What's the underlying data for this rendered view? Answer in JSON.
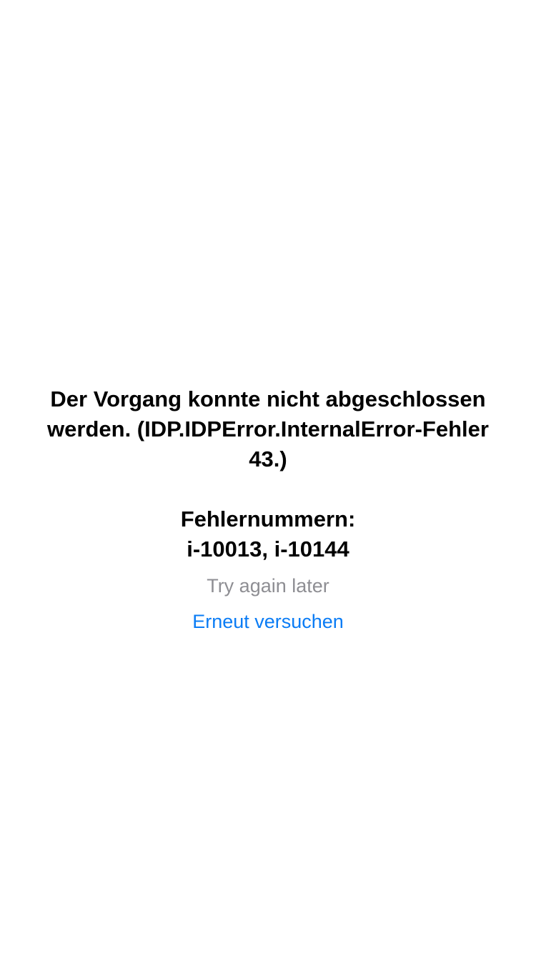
{
  "error": {
    "message": "Der Vorgang konnte nicht abgeschlossen werden. (IDP.IDPError.InternalError-Fehler 43.)",
    "codes_label": "Fehlernummern:",
    "codes": "i-10013, i-10144",
    "hint": "Try again later",
    "retry_label": "Erneut versuchen"
  },
  "colors": {
    "background": "#ffffff",
    "text": "#000000",
    "hint": "#8e8e93",
    "link": "#0a7cf5"
  }
}
